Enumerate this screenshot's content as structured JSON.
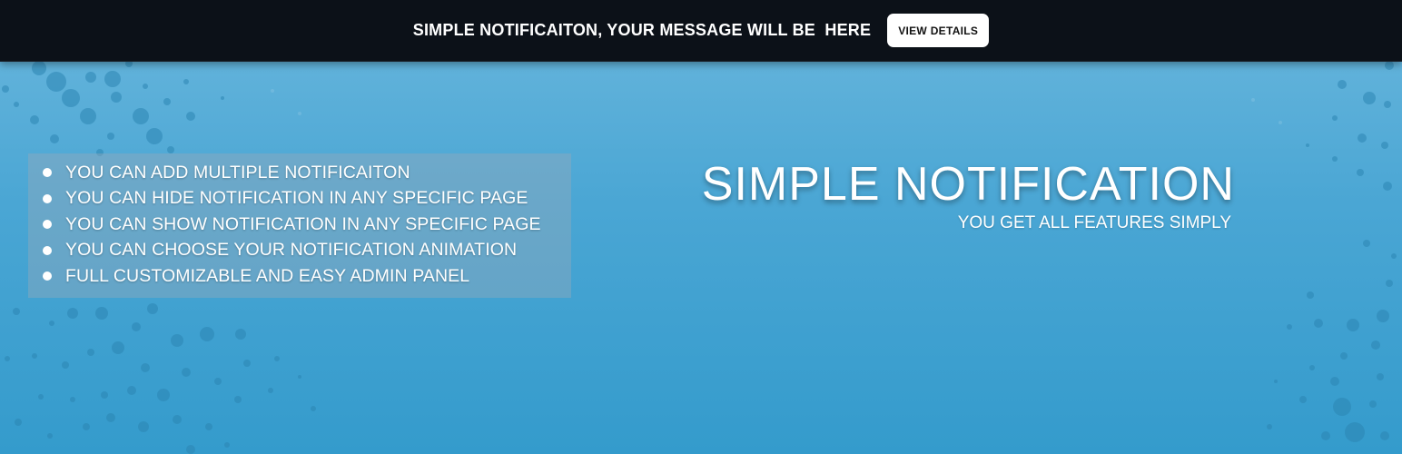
{
  "topbar": {
    "message": "SIMPLE NOTIFICAITON, YOUR MESSAGE WILL BE  HERE",
    "button_label": "VIEW DETAILS"
  },
  "features": {
    "items": [
      {
        "label": "YOU CAN ADD MULTIPLE NOTIFICAITON"
      },
      {
        "label": "YOU CAN HIDE NOTIFICATION IN ANY SPECIFIC PAGE"
      },
      {
        "label": "YOU CAN SHOW NOTIFICATION IN ANY SPECIFIC PAGE"
      },
      {
        "label": "YOU CAN CHOOSE YOUR NOTIFICATION ANIMATION"
      },
      {
        "label": "FULL CUSTOMIZABLE AND EASY ADMIN PANEL"
      }
    ]
  },
  "hero": {
    "title": "SIMPLE NOTIFICATION",
    "subtitle": "YOU GET ALL FEATURES SIMPLY"
  },
  "colors": {
    "topbar_bg": "#0c1118",
    "banner_top": "#6ab7dd",
    "banner_bottom": "#349bcc",
    "text": "#ffffff",
    "button_bg": "#ffffff"
  }
}
